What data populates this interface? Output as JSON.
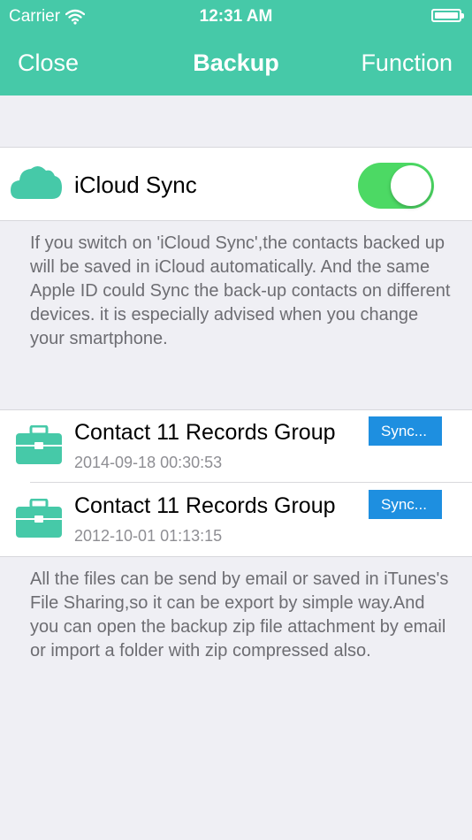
{
  "status_bar": {
    "carrier": "Carrier",
    "time": "12:31 AM"
  },
  "nav": {
    "left": "Close",
    "title": "Backup",
    "right": "Function"
  },
  "sync": {
    "label": "iCloud Sync",
    "enabled": true,
    "description": "If you switch on 'iCloud Sync',the contacts backed up will be saved in iCloud automatically. And the same Apple ID could Sync the back-up contacts on different devices. it is especially advised when you change your smartphone."
  },
  "records": [
    {
      "title": "Contact 11 Records Group",
      "date": "2014-09-18 00:30:53",
      "button": "Sync..."
    },
    {
      "title": "Contact 11 Records Group",
      "date": "2012-10-01 01:13:15",
      "button": "Sync..."
    }
  ],
  "footer_note": "All the files can be send by email or saved in iTunes's File Sharing,so it can be export by simple way.And you can open the backup zip file attachment by email or import a folder with zip compressed also.",
  "colors": {
    "accent": "#46c9a8",
    "switch_on": "#4cd964",
    "button": "#1e8fe0",
    "background": "#efeff4"
  }
}
